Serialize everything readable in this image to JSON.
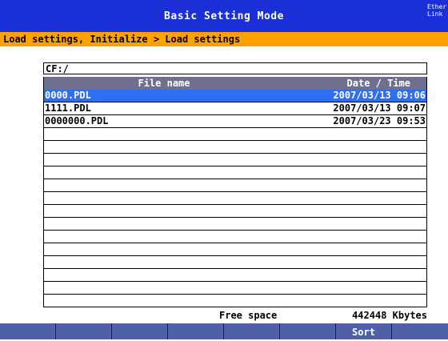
{
  "header": {
    "title": "Basic Setting Mode",
    "ethernet_line1": "Etherne",
    "ethernet_line2": "Link"
  },
  "breadcrumb": "Load settings, Initialize > Load settings",
  "path": "CF:/",
  "table": {
    "col_name": "File name",
    "col_date": "Date / Time",
    "rows": [
      {
        "name": "0000.PDL",
        "date": "2007/03/13 09:06",
        "selected": true
      },
      {
        "name": "1111.PDL",
        "date": "2007/03/13 09:07",
        "selected": false
      },
      {
        "name": "0000000.PDL",
        "date": "2007/03/23 09:53",
        "selected": false
      },
      {
        "name": "",
        "date": ""
      },
      {
        "name": "",
        "date": ""
      },
      {
        "name": "",
        "date": ""
      },
      {
        "name": "",
        "date": ""
      },
      {
        "name": "",
        "date": ""
      },
      {
        "name": "",
        "date": ""
      },
      {
        "name": "",
        "date": ""
      },
      {
        "name": "",
        "date": ""
      },
      {
        "name": "",
        "date": ""
      },
      {
        "name": "",
        "date": ""
      },
      {
        "name": "",
        "date": ""
      },
      {
        "name": "",
        "date": ""
      },
      {
        "name": "",
        "date": ""
      }
    ]
  },
  "free_space": {
    "label": "Free space",
    "value": "442448 Kbytes"
  },
  "softkeys": [
    "",
    "",
    "",
    "",
    "",
    "",
    "Sort",
    ""
  ],
  "colors": {
    "titlebar": "#1a2fd6",
    "breadcrumb": "#ffa200",
    "selected_row": "#2e6ef0",
    "table_header": "#6f6f8f",
    "softkey_bar": "#5060a8"
  }
}
